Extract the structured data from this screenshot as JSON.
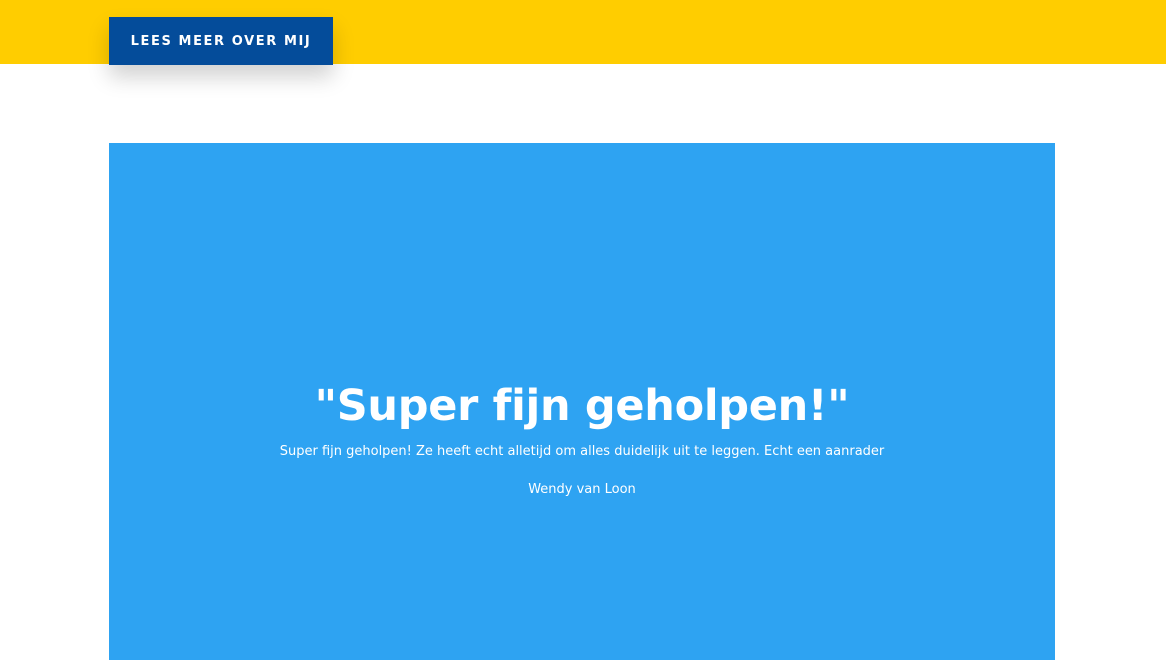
{
  "header": {
    "button_label": "LEES MEER OVER MIJ"
  },
  "testimonial": {
    "title": "\"Super fijn geholpen!\"",
    "text": "Super fijn geholpen! Ze heeft echt alletijd om alles duidelijk uit te leggen. Echt een aanrader",
    "author": "Wendy van Loon"
  },
  "colors": {
    "top_band": "#ffcd00",
    "button": "#044c9a",
    "panel": "#2ea3f2"
  }
}
